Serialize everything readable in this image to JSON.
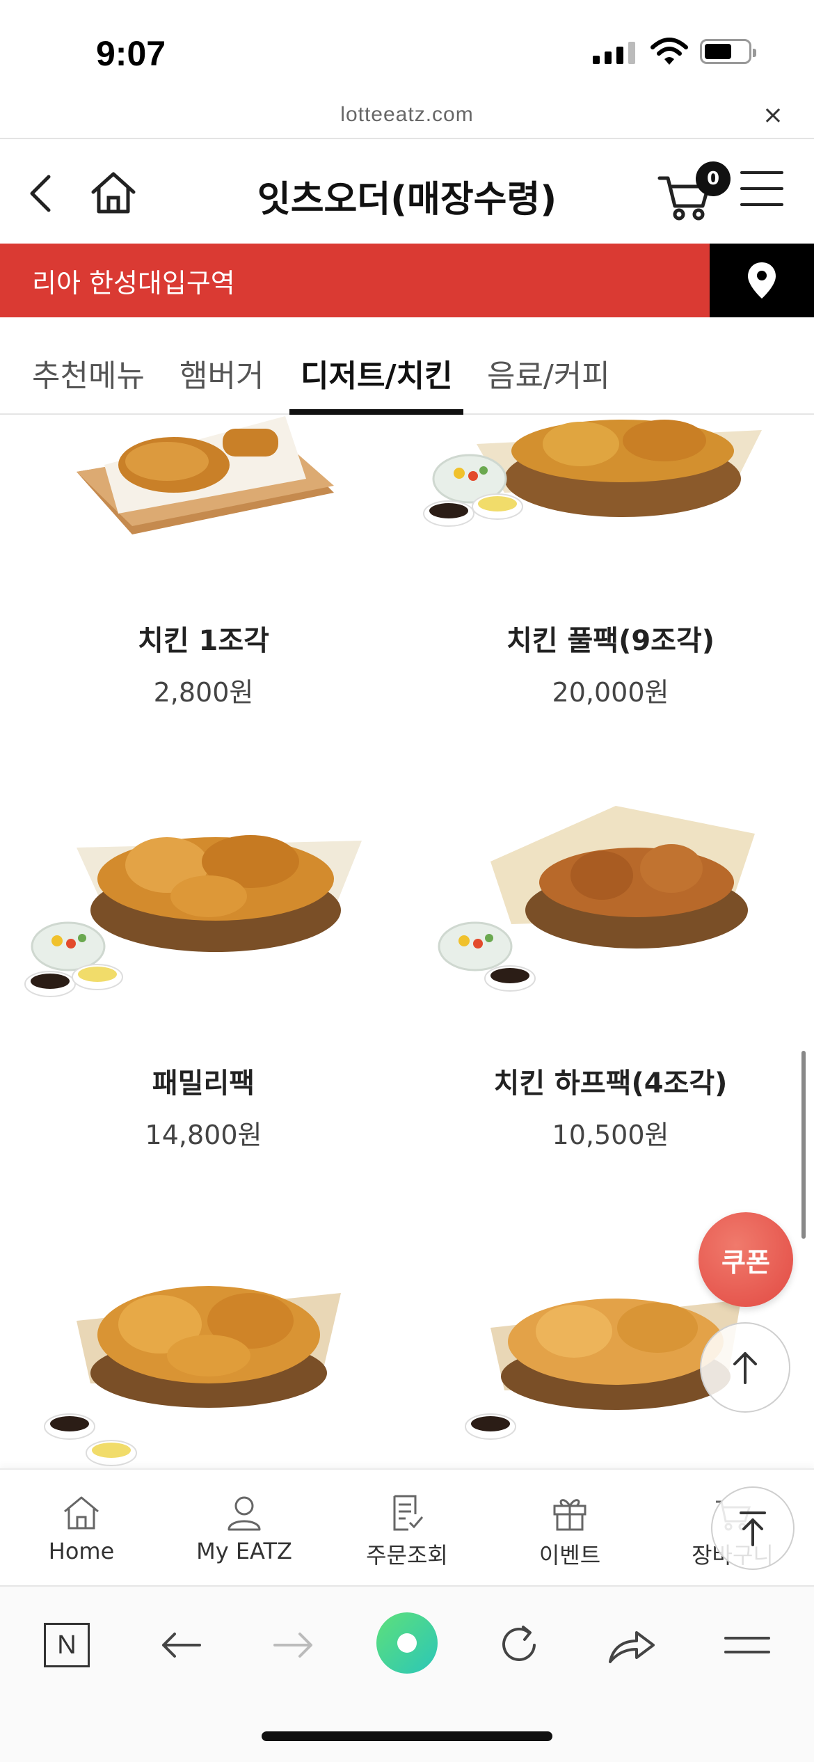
{
  "status_bar": {
    "time": "9:07"
  },
  "url_bar": {
    "url": "lotteeatz.com",
    "close_glyph": "×"
  },
  "header": {
    "title": "잇츠오더(매장수령)",
    "cart_count": "0"
  },
  "store": {
    "name": "리아 한성대입구역"
  },
  "tabs": [
    {
      "label": "추천메뉴",
      "active": false
    },
    {
      "label": "햄버거",
      "active": false
    },
    {
      "label": "디저트/치킨",
      "active": true
    },
    {
      "label": "음료/커피",
      "active": false
    }
  ],
  "products": [
    {
      "name": "치킨 1조각",
      "price": "2,800원"
    },
    {
      "name": "치킨 풀팩(9조각)",
      "price": "20,000원"
    },
    {
      "name": "패밀리팩",
      "price": "14,800원"
    },
    {
      "name": "치킨 하프팩(4조각)",
      "price": "10,500원"
    },
    {
      "name": "",
      "price": ""
    },
    {
      "name": "",
      "price": ""
    }
  ],
  "floating": {
    "coupon_label": "쿠폰"
  },
  "bottom_nav": [
    {
      "label": "Home",
      "icon": "home-icon"
    },
    {
      "label": "My EATZ",
      "icon": "person-icon"
    },
    {
      "label": "주문조회",
      "icon": "order-list-icon"
    },
    {
      "label": "이벤트",
      "icon": "gift-icon"
    },
    {
      "label": "장바구니",
      "icon": "cart-icon"
    }
  ],
  "browser_bar": {
    "n_label": "N"
  },
  "colors": {
    "brand_red": "#da3a33",
    "coupon": "#e24a43",
    "dark": "#111111",
    "naver_green": "#3fd58e"
  }
}
